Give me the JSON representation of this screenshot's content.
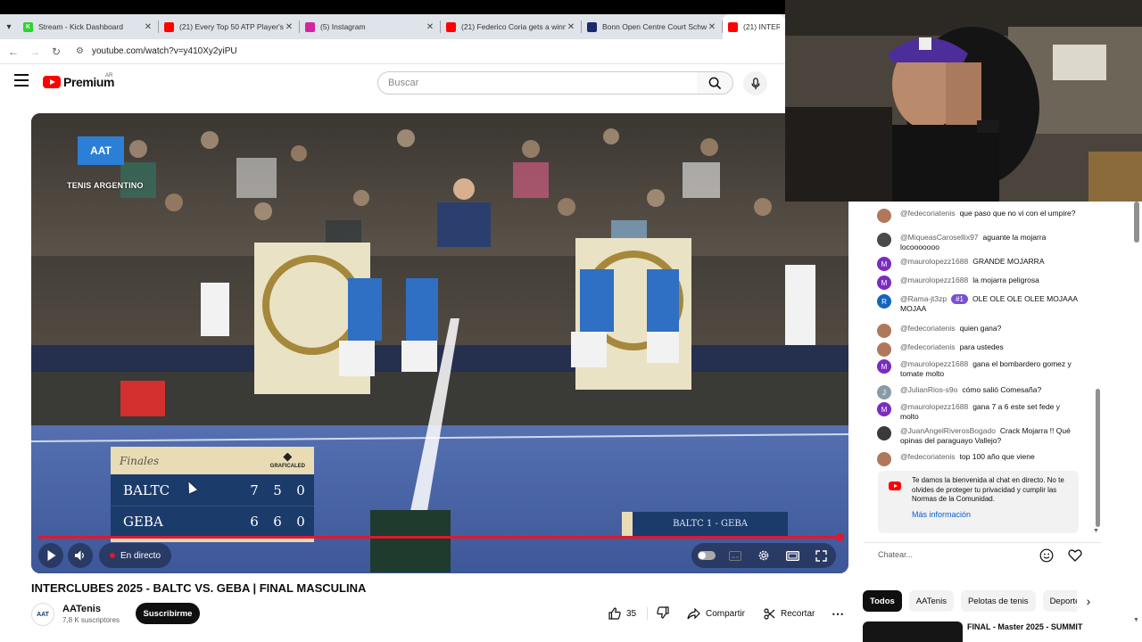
{
  "browser": {
    "tabs": [
      {
        "title": "Stream - Kick Dashboard",
        "favicon_color": "#2bd52b",
        "favicon_letter": "K"
      },
      {
        "title": "(21) Every Top 50 ATP Player's L",
        "favicon_color": "#ff0000",
        "favicon_letter": ""
      },
      {
        "title": "(5) Instagram",
        "favicon_color": "#d6249f",
        "favicon_letter": ""
      },
      {
        "title": "(21) Federico Coria gets a winn",
        "favicon_color": "#ff0000",
        "favicon_letter": ""
      },
      {
        "title": "Bonn Open Centre Court Schw",
        "favicon_color": "#1a2a6c",
        "favicon_letter": ""
      },
      {
        "title": "(21) INTER",
        "favicon_color": "#ff0000",
        "favicon_letter": ""
      }
    ],
    "url": "youtube.com/watch?v=y410Xy2yiPU"
  },
  "header": {
    "logo_text": "Premium",
    "region": "AR",
    "search_placeholder": "Buscar"
  },
  "player": {
    "brand_logo": "AAT",
    "brand_caption": "TENIS ARGENTINO",
    "scoreboard": {
      "sponsor": "Finales",
      "sponsor_right": "GRAFICALED",
      "rows": [
        {
          "team": "BALTC",
          "sets": [
            "7",
            "5",
            "0"
          ]
        },
        {
          "team": "GEBA",
          "sets": [
            "6",
            "6",
            "0"
          ]
        }
      ]
    },
    "lower_badge": "BALTC 1 - GEBA",
    "live_label": "En directo",
    "progress": 1.0
  },
  "video": {
    "title": "INTERCLUBES 2025 - BALTC VS. GEBA | FINAL MASCULINA",
    "channel_name": "AATenis",
    "channel_avatar_text": "AAT",
    "subscribers": "7,8 K suscriptores",
    "subscribe_label": "Suscribirme",
    "likes": "35",
    "share_label": "Compartir",
    "clip_label": "Recortar"
  },
  "chat": {
    "messages": [
      {
        "user": "@fedecoriatenis",
        "text": "que paso que no vi con el umpire?",
        "avatar_color": "#b0785a",
        "avatar_letter": ""
      },
      {
        "user": "@MiqueasCarosellix97",
        "text": "aguante la mojarra locooooooo",
        "avatar_color": "#4a4a4a",
        "avatar_letter": ""
      },
      {
        "user": "@maurolopezz1688",
        "text": "GRANDE MOJARRA",
        "avatar_color": "#7b2cbf",
        "avatar_letter": "M"
      },
      {
        "user": "@maurolopezz1688",
        "text": "la mojarra peligrosa",
        "avatar_color": "#7b2cbf",
        "avatar_letter": "M"
      },
      {
        "user": "@Rama-jt3zp",
        "badge": "#1",
        "text": "OLE OLE OLE OLEE MOJAAA MOJAA",
        "avatar_color": "#1565c0",
        "avatar_letter": "R"
      },
      {
        "user": "@fedecoriatenis",
        "text": "quien gana?",
        "avatar_color": "#b0785a",
        "avatar_letter": ""
      },
      {
        "user": "@fedecoriatenis",
        "text": "para ustedes",
        "avatar_color": "#b0785a",
        "avatar_letter": ""
      },
      {
        "user": "@maurolopezz1688",
        "text": "gana el bombardero gomez y tomate molto",
        "avatar_color": "#7b2cbf",
        "avatar_letter": "M"
      },
      {
        "user": "@JulianRios-s9o",
        "text": "cómo salió Comesaña?",
        "avatar_color": "#8a9ba8",
        "avatar_letter": "J"
      },
      {
        "user": "@maurolopezz1688",
        "text": "gana 7 a 6 este set fede y molto",
        "avatar_color": "#7b2cbf",
        "avatar_letter": "M"
      },
      {
        "user": "@JuanAngelRiverosBogado",
        "text": "Crack Mojarra !! Qué opinas del paraguayo Vallejo?",
        "avatar_color": "#3a3a3a",
        "avatar_letter": ""
      },
      {
        "user": "@fedecoriatenis",
        "text": "top 100 año que viene",
        "avatar_color": "#b0785a",
        "avatar_letter": ""
      }
    ],
    "welcome_text": "Te damos la bienvenida al chat en directo. No te olvides de proteger tu privacidad y cumplir las Normas de la Comunidad.",
    "welcome_link": "Más información",
    "input_placeholder": "Chatear..."
  },
  "chips": [
    "Todos",
    "AATenis",
    "Pelotas de tenis",
    "Deporte"
  ],
  "next_video_title": "FINAL - Master 2025 - SUMMIT",
  "colors": {
    "youtube_red": "#ff0000",
    "progress_red": "#e0182d",
    "scoreboard_navy": "#1b3b6b",
    "scoreboard_cream": "#e9dbb3",
    "link_blue": "#065fd4"
  }
}
